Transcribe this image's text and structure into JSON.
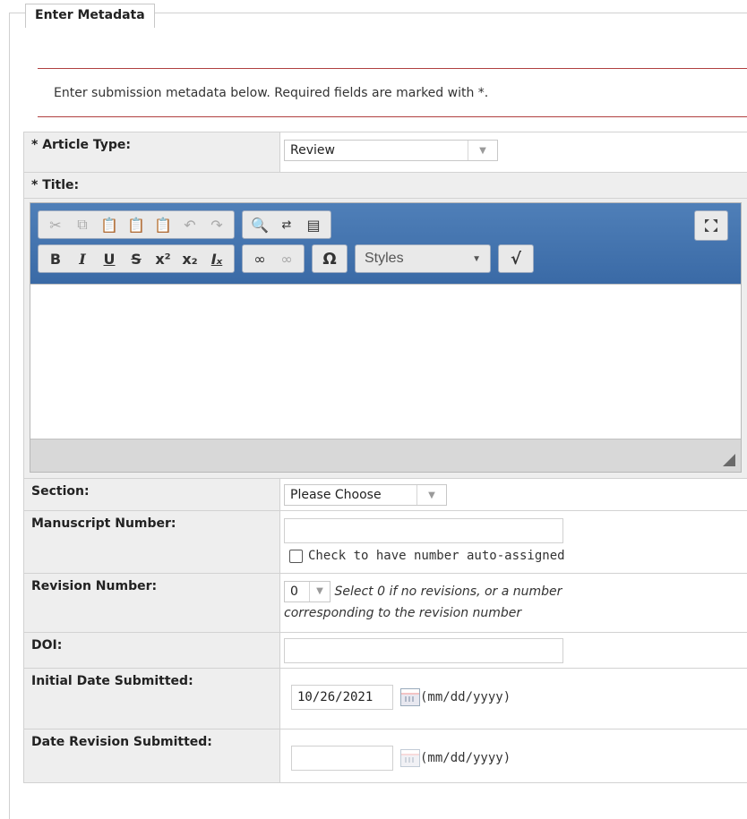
{
  "panel": {
    "legend": "Enter Metadata",
    "intro": "Enter submission metadata below. Required fields are marked with *."
  },
  "article_type": {
    "label": "* Article Type:",
    "selected": "Review"
  },
  "title": {
    "label": "* Title:",
    "editor": {
      "styles_label": "Styles",
      "toolbar_row1": [
        "cut-icon",
        "copy-icon",
        "paste-icon",
        "paste-text-icon",
        "paste-word-icon",
        "undo-icon",
        "redo-icon",
        "find-icon",
        "replace-icon",
        "select-all-icon",
        "maximize-icon"
      ],
      "toolbar_row2": [
        "bold-icon",
        "italic-icon",
        "underline-icon",
        "strike-icon",
        "superscript-icon",
        "subscript-icon",
        "remove-format-icon",
        "link-icon",
        "unlink-icon",
        "omega-icon",
        "styles-dropdown",
        "math-icon"
      ]
    }
  },
  "section": {
    "label": "Section:",
    "selected": "Please Choose"
  },
  "manuscript": {
    "label": "Manuscript Number:",
    "value": "",
    "auto_assign_label": "Check to have number auto-assigned"
  },
  "revision": {
    "label": "Revision Number:",
    "selected": "0",
    "hint_line1": "Select 0 if no revisions, or a number",
    "hint_line2": "corresponding to the revision number"
  },
  "doi": {
    "label": "DOI:",
    "value": ""
  },
  "initial_date": {
    "label": "Initial Date Submitted:",
    "value": "10/26/2021",
    "format_hint": "(mm/dd/yyyy)"
  },
  "revision_date": {
    "label": "Date Revision Submitted:",
    "value": "",
    "format_hint": "(mm/dd/yyyy)"
  }
}
